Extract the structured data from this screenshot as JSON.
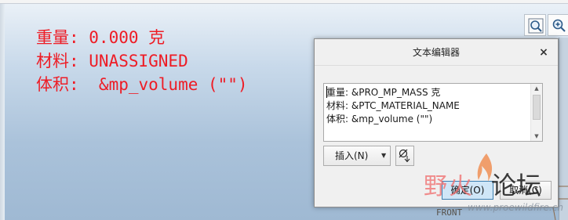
{
  "drawing_note": {
    "line1": "重量: 0.000 克",
    "line2": "材料: UNASSIGNED",
    "line3": "体积:  &mp_volume (\"\")"
  },
  "toolbar": {
    "zoom_fit_icon": "zoom-fit-icon",
    "zoom_in_icon": "zoom-in-icon"
  },
  "dialog": {
    "title": "文本编辑器",
    "close_label": "×",
    "editor": {
      "lines": [
        "重量: &PRO_MP_MASS 克",
        "材料: &PTC_MATERIAL_NAME",
        "体积: &mp_volume (\"\")"
      ]
    },
    "insert_label": "插入(N)",
    "symbol_icon": "special-symbol-icon",
    "ok_label": "确定(O)",
    "cancel_label": "取消(C)"
  },
  "watermark": {
    "text_a": "野火",
    "text_b": "论坛",
    "url": "www.proewildfire.cn"
  },
  "drawing": {
    "front_label": "FRONT"
  },
  "colors": {
    "note_red": "#ee1c25",
    "accent_blue": "#3c7fb1"
  }
}
